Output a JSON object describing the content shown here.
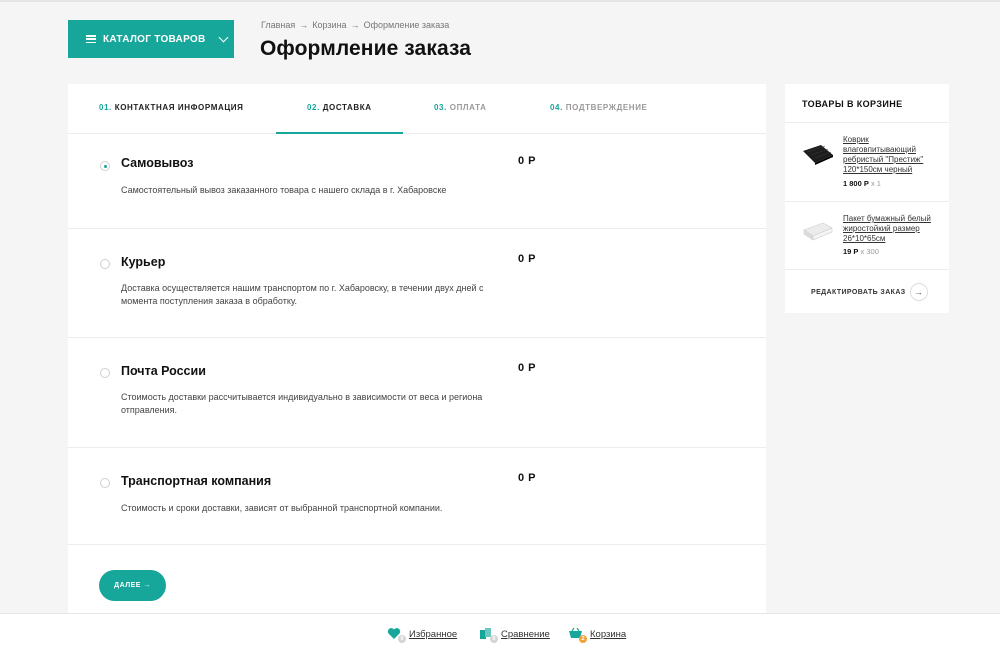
{
  "header": {
    "catalog_label": "КАТАЛОГ ТОВАРОВ",
    "breadcrumb": [
      "Главная",
      "Корзина",
      "Оформление заказа"
    ],
    "breadcrumb_sep": "→",
    "title": "Оформление заказа"
  },
  "steps": [
    {
      "num": "01.",
      "label": "КОНТАКТНАЯ ИНФОРМАЦИЯ",
      "state": "done"
    },
    {
      "num": "02.",
      "label": "ДОСТАВКА",
      "state": "active"
    },
    {
      "num": "03.",
      "label": "ОПЛАТА",
      "state": "pending"
    },
    {
      "num": "04.",
      "label": "ПОДТВЕРЖДЕНИЕ",
      "state": "pending"
    }
  ],
  "delivery_options": [
    {
      "title": "Самовывоз",
      "price": "0 Р",
      "description": "Самостоятельный вывоз заказанного товара с нашего склада в г. Хабаровске",
      "selected": true
    },
    {
      "title": "Курьер",
      "price": "0 Р",
      "description": "Доставка осуществляется нашим транспортом по г. Хабаровску, в течении двух дней с момента поступления заказа в обработку.",
      "selected": false
    },
    {
      "title": "Почта России",
      "price": "0 Р",
      "description": "Стоимость доставки рассчитывается индивидуально в зависимости от веса и региона отправления.",
      "selected": false
    },
    {
      "title": "Транспортная компания",
      "price": "0 Р",
      "description": "Стоимость и сроки доставки, зависят от выбранной транспортной компании.",
      "selected": false
    }
  ],
  "next_button": "ДАЛЕЕ →",
  "cart": {
    "title": "ТОВАРЫ В КОРЗИНЕ",
    "items": [
      {
        "name": "Коврик влаговпитывающий ребристый \"Престиж\" 120*150см черный",
        "price": "1 800 Р",
        "qty": "x 1"
      },
      {
        "name": "Пакет бумажный белый жиростойкий размер 26*10*65см",
        "price": "19 Р",
        "qty": "x 300"
      }
    ],
    "edit_label": "РЕДАКТИРОВАТЬ ЗАКАЗ",
    "edit_arrow": "→"
  },
  "footer": {
    "favorites_label": "Избранное",
    "favorites_count": "0",
    "compare_label": "Сравнение",
    "compare_count": "0",
    "cart_label": "Корзина",
    "cart_count": "2"
  },
  "colors": {
    "accent": "#17a69a",
    "badge_orange": "#f0a23a"
  }
}
